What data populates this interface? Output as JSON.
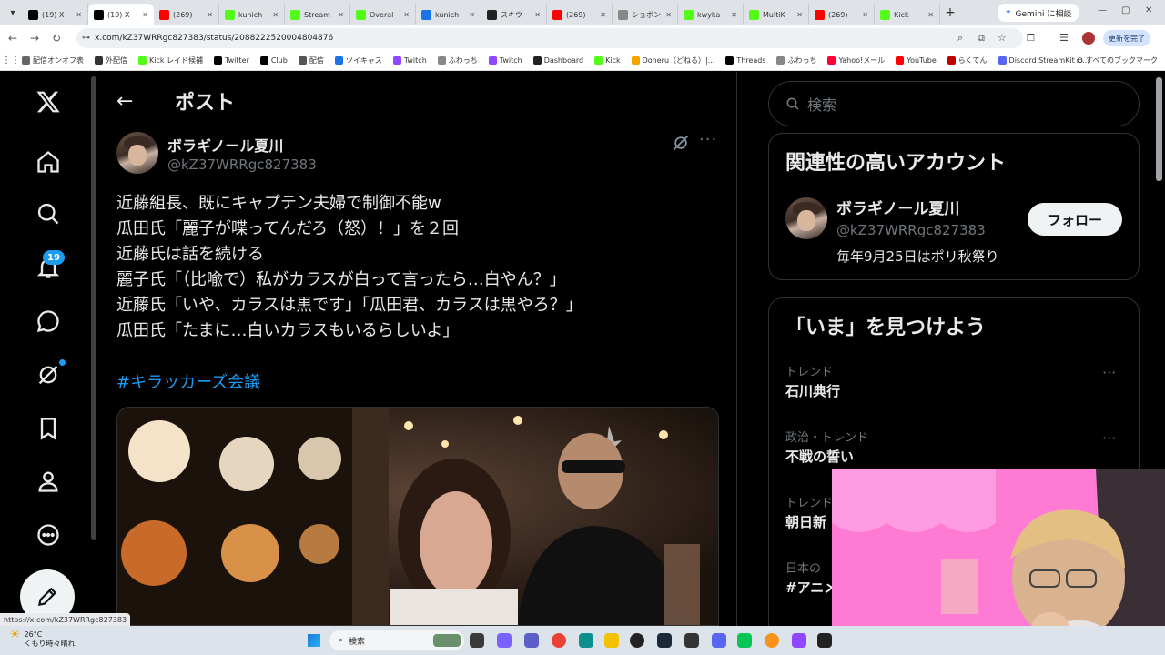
{
  "browser": {
    "tabs": [
      {
        "label": "(19) X",
        "fav": "x-favicon",
        "color": "#000000"
      },
      {
        "label": "(19) X",
        "fav": "x-favicon",
        "color": "#000000",
        "active": true
      },
      {
        "label": "(269)",
        "fav": "youtube-favicon",
        "color": "#ff0000"
      },
      {
        "label": "kunich",
        "fav": "kick-favicon",
        "color": "#53fc18"
      },
      {
        "label": "Stream",
        "fav": "kick-favicon",
        "color": "#53fc18"
      },
      {
        "label": "Overal",
        "fav": "kick-favicon",
        "color": "#53fc18"
      },
      {
        "label": "kunich",
        "fav": "globe-favicon",
        "color": "#1a73e8"
      },
      {
        "label": "スキウ",
        "fav": "site-favicon",
        "color": "#222222"
      },
      {
        "label": "(269)",
        "fav": "youtube-favicon",
        "color": "#ff0000"
      },
      {
        "label": "ショボン",
        "fav": "chevron-favicon",
        "color": "#888888"
      },
      {
        "label": "kwyka",
        "fav": "kick-favicon",
        "color": "#53fc18"
      },
      {
        "label": "MultiK",
        "fav": "kick-favicon",
        "color": "#53fc18"
      },
      {
        "label": "(269)",
        "fav": "youtube-favicon",
        "color": "#ff0000"
      },
      {
        "label": "Kick",
        "fav": "kick-favicon",
        "color": "#53fc18"
      }
    ],
    "new_tab": "+",
    "gemini_button": "Gemini に相談",
    "url": "x.com/kZ37WRRgc827383/status/2088222520004804876",
    "update_button": "更新を完了",
    "bookmarks": [
      {
        "label": "配信オンオフ表",
        "color": "#666666"
      },
      {
        "label": "外配信",
        "color": "#333333"
      },
      {
        "label": "Kick レイド候補",
        "color": "#53fc18"
      },
      {
        "label": "Twitter",
        "color": "#000000"
      },
      {
        "label": "Club",
        "color": "#000000"
      },
      {
        "label": "配信",
        "color": "#555555"
      },
      {
        "label": "ツイキャス",
        "color": "#1a73e8"
      },
      {
        "label": "Twitch",
        "color": "#9146ff"
      },
      {
        "label": "ふわっち",
        "color": "#888888"
      },
      {
        "label": "Twitch",
        "color": "#9146ff"
      },
      {
        "label": "Dashboard",
        "color": "#222222"
      },
      {
        "label": "Kick",
        "color": "#53fc18"
      },
      {
        "label": "Doneru（どねる）|...",
        "color": "#f4a300"
      },
      {
        "label": "Threads",
        "color": "#000000"
      },
      {
        "label": "ふわっち",
        "color": "#888888"
      },
      {
        "label": "Yahoo!メール",
        "color": "#ff0033"
      },
      {
        "label": "YouTube",
        "color": "#ff0000"
      },
      {
        "label": "らくてん",
        "color": "#bf0000"
      },
      {
        "label": "Discord StreamKit O...",
        "color": "#5865f2"
      }
    ],
    "all_bookmarks": "すべてのブックマーク",
    "status_url": "https://x.com/kZ37WRRgc827383"
  },
  "nav": {
    "notifications_badge": "19"
  },
  "post": {
    "header_title": "ポスト",
    "author_name": "ボラギノール夏川",
    "author_handle": "@kZ37WRRgc827383",
    "lines": [
      "近藤組長、既にキャプテン夫婦で制御不能w",
      "瓜田氏「麗子が喋ってんだろ（怒）！」を２回",
      "近藤氏は話を続ける",
      "麗子氏「（比喩で）私がカラスが白って言ったら…白やん？」",
      "近藤氏「いや、カラスは黒です」「瓜田君、カラスは黒やろ？」",
      "瓜田氏「たまに…白いカラスもいるらしいよ」"
    ],
    "hashtag": "#キラッカーズ会議"
  },
  "sidebar": {
    "search_placeholder": "検索",
    "relevant_title": "関連性の高いアカウント",
    "account": {
      "name": "ボラギノール夏川",
      "handle": "@kZ37WRRgc827383",
      "bio": "毎年9月25日はポリ秋祭り",
      "follow_label": "フォロー"
    },
    "trends_title": "「いま」を見つけよう",
    "trends": [
      {
        "context": "トレンド",
        "name": "石川典行"
      },
      {
        "context": "政治・トレンド",
        "name": "不戦の誓い"
      },
      {
        "context": "トレンド",
        "name": "朝日新"
      },
      {
        "context": "日本の",
        "name": "#アニメ"
      }
    ]
  },
  "taskbar": {
    "temp": "26°C",
    "weather": "くもり時々晴れ",
    "search_label": "検索"
  }
}
